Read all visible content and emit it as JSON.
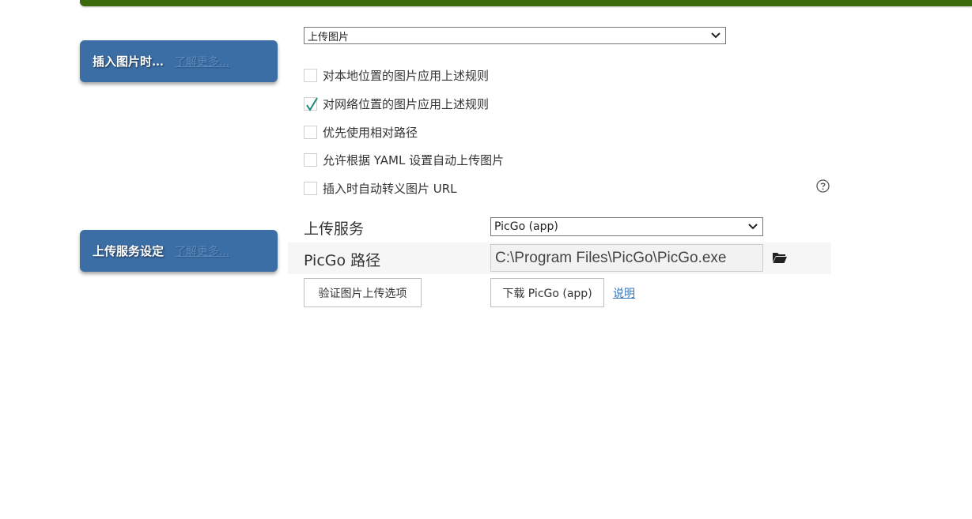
{
  "image_insert": {
    "tag_title": "插入图片时…",
    "tag_link": "了解更多...",
    "action_select": "上传图片",
    "options": [
      {
        "label": "对本地位置的图片应用上述规则",
        "checked": false
      },
      {
        "label": "对网络位置的图片应用上述规则",
        "checked": true
      },
      {
        "label": "优先使用相对路径",
        "checked": false
      },
      {
        "label": "允许根据 YAML 设置自动上传图片",
        "checked": false
      },
      {
        "label": "插入时自动转义图片 URL",
        "checked": false
      }
    ],
    "help_icon": "question-circle-icon"
  },
  "upload_service": {
    "tag_title": "上传服务设定",
    "tag_link": "了解更多...",
    "service_label": "上传服务",
    "service_select": "PicGo (app)",
    "path_label": "PicGo 路径",
    "path_value": "C:\\Program Files\\PicGo\\PicGo.exe",
    "folder_icon": "folder-open-icon",
    "verify_button": "验证图片上传选项",
    "download_button": "下载 PicGo (app)",
    "help_link": "说明"
  },
  "colors": {
    "top_bar": "#3b6a0c",
    "tag_background": "#3b6ea5",
    "check_color": "#1a8a7a",
    "link": "#3b76b8"
  }
}
